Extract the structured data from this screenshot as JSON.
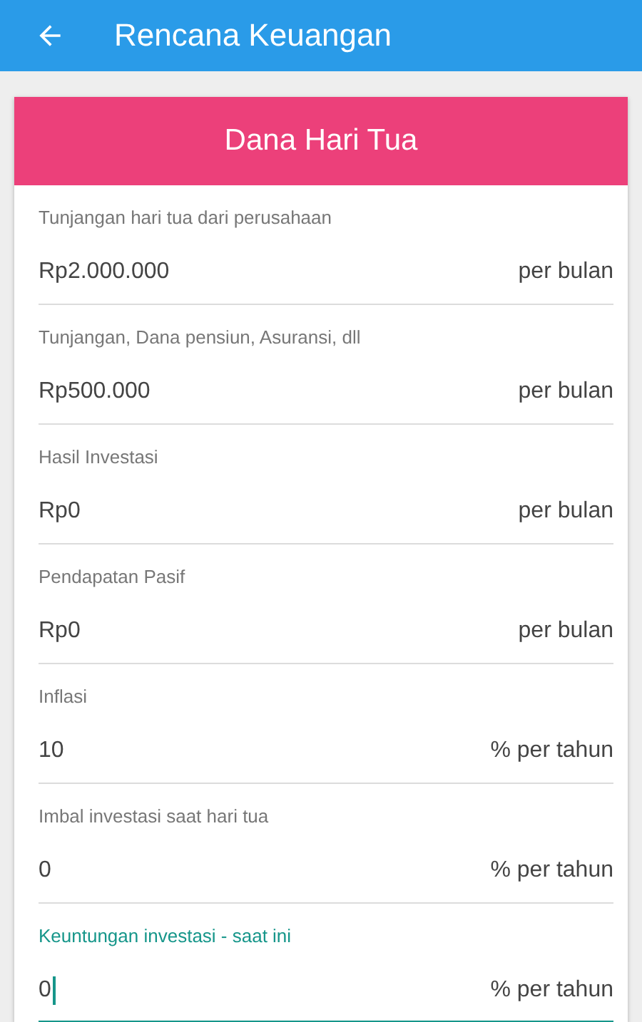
{
  "app_bar": {
    "title": "Rencana Keuangan"
  },
  "card": {
    "title": "Dana Hari Tua",
    "fields": [
      {
        "label": "Tunjangan hari tua dari perusahaan",
        "value": "Rp2.000.000",
        "unit": "per bulan",
        "focused": false
      },
      {
        "label": "Tunjangan, Dana pensiun, Asuransi, dll",
        "value": "Rp500.000",
        "unit": "per bulan",
        "focused": false
      },
      {
        "label": "Hasil Investasi",
        "value": "Rp0",
        "unit": "per bulan",
        "focused": false
      },
      {
        "label": "Pendapatan Pasif",
        "value": "Rp0",
        "unit": "per bulan",
        "focused": false
      },
      {
        "label": "Inflasi",
        "value": "10",
        "unit": "% per tahun",
        "focused": false
      },
      {
        "label": "Imbal investasi saat hari tua",
        "value": "0",
        "unit": "% per tahun",
        "focused": false
      },
      {
        "label": "Keuntungan investasi - saat ini",
        "value": "0",
        "unit": "% per tahun",
        "focused": true
      }
    ]
  }
}
